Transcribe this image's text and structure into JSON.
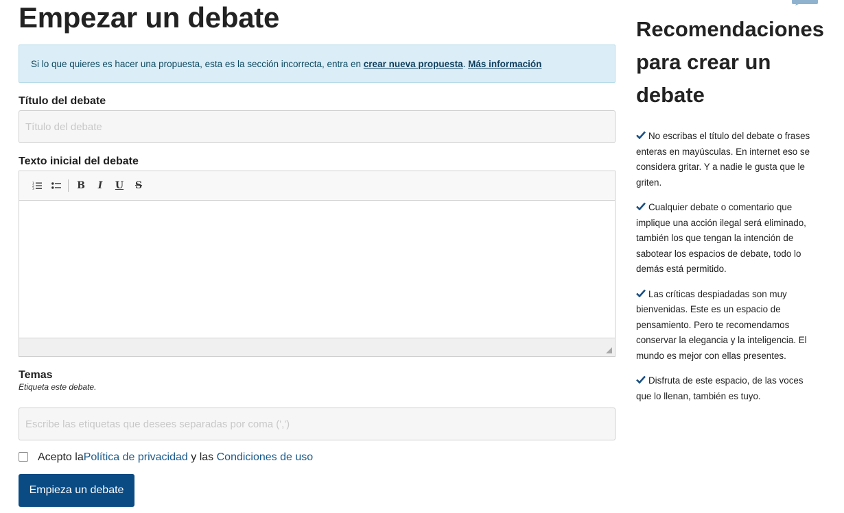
{
  "page_title": "Empezar un debate",
  "callout": {
    "text": "Si lo que quieres es hacer una propuesta, esta es la sección incorrecta, entra en ",
    "link1": "crear nueva propuesta",
    "separator": ". ",
    "link2": "Más información"
  },
  "title_field": {
    "label": "Título del debate",
    "placeholder": "Título del debate",
    "value": ""
  },
  "body_field": {
    "label": "Texto inicial del debate",
    "toolbar": {
      "ordered_list": "ordered-list-icon",
      "bullet_list": "bullet-list-icon",
      "bold": "B",
      "italic": "I",
      "underline": "U",
      "strike": "S"
    },
    "value": ""
  },
  "tags_field": {
    "label": "Temas",
    "help": "Etiqueta este debate.",
    "placeholder": "Escribe las etiquetas que desees separadas por coma (',')",
    "value": ""
  },
  "terms": {
    "prefix": "Acepto la ",
    "privacy_link": "Política de privacidad",
    "middle": " y las ",
    "conditions_link": "Condiciones de uso",
    "checked": false
  },
  "submit_label": "Empieza un debate",
  "sidebar": {
    "title": "Recomendaciones para crear un debate",
    "items": [
      "No escribas el título del debate o frases enteras en mayúsculas. En internet eso se considera gritar. Y a nadie le gusta que le griten.",
      "Cualquier debate o comentario que implique una acción ilegal será eliminado, también los que tengan la intención de sabotear los espacios de debate, todo lo demás está permitido.",
      "Las críticas despiadadas son muy bienvenidas. Este es un espacio de pensamiento. Pero te recomendamos conservar la elegancia y la inteligencia. El mundo es mejor con ellas presentes.",
      "Disfruta de este espacio, de las voces que lo llenan, también es tuyo."
    ]
  },
  "colors": {
    "primary": "#0a4b84",
    "callout_bg": "#dbedf6",
    "check": "#1a4f80",
    "link": "#1a5a8a"
  }
}
